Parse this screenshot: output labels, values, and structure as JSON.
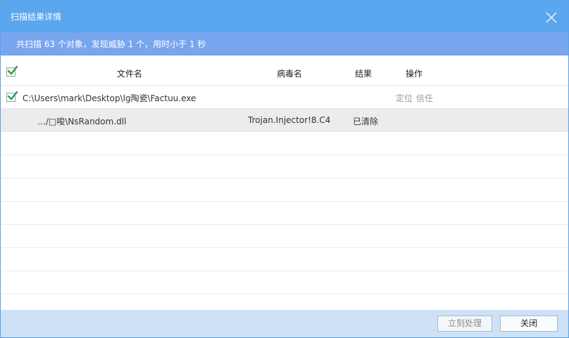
{
  "window": {
    "title": "扫描结果详情",
    "summary": "共扫描 63 个对象，发现威胁 1 个，用时小于 1 秒"
  },
  "table": {
    "headers": {
      "filename": "文件名",
      "virus": "病毒名",
      "result": "结果",
      "action": "操作"
    },
    "rows": [
      {
        "path": "C:\\Users\\mark\\Desktop\\lg陶瓷\\Factuu.exe",
        "actions": [
          "定位",
          "信任"
        ]
      },
      {
        "path": "…/□唆\\NsRandom.dll",
        "virus": "Trojan.Injector!8.C4",
        "result": "已清除"
      }
    ]
  },
  "footer": {
    "process_label": "立刻处理",
    "close_label": "关闭"
  },
  "colors": {
    "titlebar": "#5ba7ef",
    "summary_bar": "#77a6ef",
    "footer": "#cde2f7",
    "check": "#2e9e3e"
  },
  "icons": [
    "close-icon",
    "checkbox-checked-icon"
  ]
}
